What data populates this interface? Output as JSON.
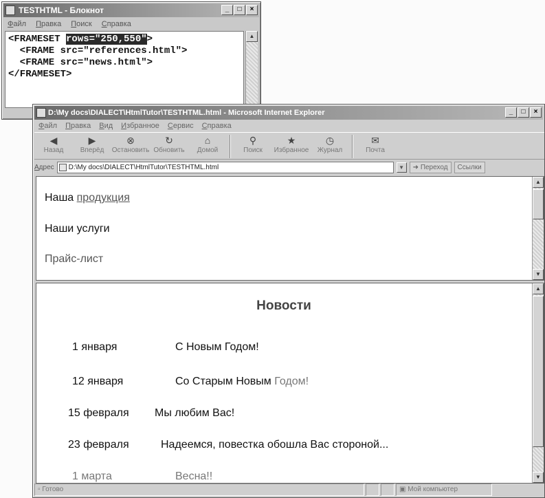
{
  "notepad": {
    "title": "TESTHTML - Блокнот",
    "menu": [
      "Файл",
      "Правка",
      "Поиск",
      "Справка"
    ],
    "code": {
      "line1_prefix": "<FRAMESET ",
      "line1_selected": "rows=\"250,550\"",
      "line1_suffix": ">",
      "line2": "  <FRAME src=\"references.html\">",
      "line3": "  <FRAME src=\"news.html\">",
      "line4": "</FRAMESET>"
    }
  },
  "browser": {
    "title": "D:\\My docs\\DIALECT\\HtmlTutor\\TESTHTML.html - Microsoft Internet Explorer",
    "menu": [
      "Файл",
      "Правка",
      "Вид",
      "Избранное",
      "Сервис",
      "Справка"
    ],
    "toolbar": [
      {
        "label": "Назад",
        "icon": "back-arrow-icon"
      },
      {
        "label": "Вперёд",
        "icon": "forward-arrow-icon"
      },
      {
        "label": "Остановить",
        "icon": "stop-icon"
      },
      {
        "label": "Обновить",
        "icon": "refresh-icon"
      },
      {
        "label": "Домой",
        "icon": "home-icon"
      },
      {
        "label": "Поиск",
        "icon": "search-icon"
      },
      {
        "label": "Избранное",
        "icon": "favorites-icon"
      },
      {
        "label": "Журнал",
        "icon": "history-icon"
      },
      {
        "label": "Почта",
        "icon": "mail-icon"
      }
    ],
    "address_label": "Адрес",
    "address_value": "D:\\My docs\\DIALECT\\HtmlTutor\\TESTHTML.html",
    "go_label": "Переход",
    "links_label": "Ссылки",
    "status_left": "Готово",
    "status_zone": "Мой компьютер"
  },
  "frame_top": {
    "line1_text": "Наша ",
    "line1_link": "продукция",
    "line2_text": "Наши услуги",
    "line3_link": "Прайс-лист"
  },
  "frame_bottom": {
    "title": "Новости",
    "rows": [
      {
        "date": "1 января",
        "text": "С Новым Годом!"
      },
      {
        "date": "12 января",
        "text": "Со Старым Новым ",
        "accent": "Годом!"
      },
      {
        "date": "15 февраля",
        "text": "Мы любим Вас!"
      },
      {
        "date": "23 февраля",
        "text": "Надеемся, повестка обошла Вас стороной..."
      },
      {
        "date": "1 марта",
        "text": "Весна!!"
      }
    ]
  }
}
